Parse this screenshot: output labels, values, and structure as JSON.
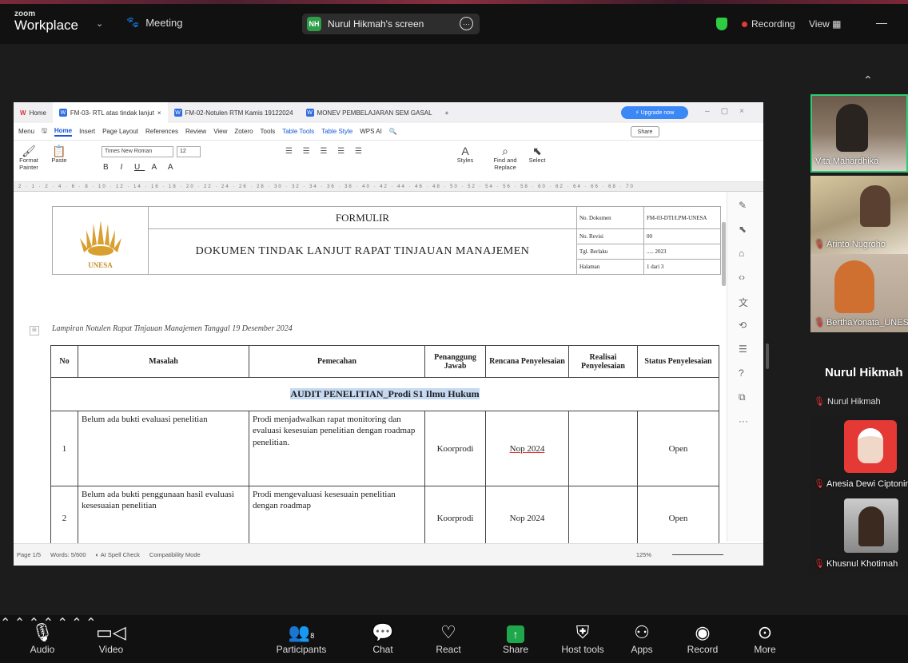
{
  "zoom": {
    "brand_small": "zoom",
    "brand_large": "Workplace",
    "meeting_label": "Meeting",
    "share_badge": "NH",
    "share_title": "Nurul Hikmah's screen",
    "recording": "Recording",
    "view": "View",
    "big_name": "Nurul Hikmah",
    "small_name": "Nurul Hikmah",
    "participants_count": "8"
  },
  "participants": [
    {
      "name": "Vita Mahardhika"
    },
    {
      "name": "Arinto Nugroho"
    },
    {
      "name": "BerthaYonata_UNESA"
    },
    {
      "name": "Anesia Dewi Ciptonin"
    },
    {
      "name": "Khusnul Khotimah"
    }
  ],
  "toolbar": [
    {
      "label": "Audio",
      "icon": "mic-muted-icon"
    },
    {
      "label": "Video",
      "icon": "video-icon"
    },
    {
      "label": "Participants",
      "icon": "participants-icon"
    },
    {
      "label": "Chat",
      "icon": "chat-icon"
    },
    {
      "label": "React",
      "icon": "heart-icon"
    },
    {
      "label": "Share",
      "icon": "share-icon"
    },
    {
      "label": "Host tools",
      "icon": "shield-icon"
    },
    {
      "label": "Apps",
      "icon": "apps-icon"
    },
    {
      "label": "Record",
      "icon": "record-icon"
    },
    {
      "label": "More",
      "icon": "more-icon"
    }
  ],
  "wps": {
    "home_tab": "Home",
    "tabs": [
      "FM-03- RTL atas tindak lanjut",
      "FM-02-Notulen RTM Kamis 19122024",
      "MONEV PEMBELAJARAN SEM GASAL"
    ],
    "upgrade": "Upgrade now",
    "menu": [
      "Menu",
      "Home",
      "Insert",
      "Page Layout",
      "References",
      "Review",
      "View",
      "Zotero",
      "Tools",
      "Table Tools",
      "Table Style",
      "WPS AI"
    ],
    "share_btn": "Share",
    "font_name": "Times New Roman",
    "font_size": "12",
    "ribbon": {
      "format_painter": "Format Painter",
      "paste": "Paste",
      "styles": "Styles",
      "find_replace": "Find and Replace",
      "select": "Select"
    },
    "status": {
      "page": "Page 1/5",
      "words": "Words: 5/600",
      "spell": "AI Spell Check",
      "compat": "Compatibility Mode",
      "zoom": "125%"
    }
  },
  "doc": {
    "form_title": "FORMULIR",
    "doc_title": "DOKUMEN TINDAK LANJUT RAPAT TINJAUAN MANAJEMEN",
    "logo_text": "UNESA",
    "meta": [
      {
        "key": "No. Dokumen",
        "val": "FM-03-DTI/LPM-UNESA"
      },
      {
        "key": "No. Revisi",
        "val": "00"
      },
      {
        "key": "Tgl. Berlaku",
        "val": "..... 2023"
      },
      {
        "key": "Halaman",
        "val": "1 dari 3"
      }
    ],
    "lampiran": "Lampiran Notulen Rapat Tinjauan Manajemen Tanggal 19 Desember 2024",
    "headers": [
      "No",
      "Masalah",
      "Pemecahan",
      "Penanggung Jawab",
      "Rencana Penyelesaian",
      "Realisai Penyelesaian",
      "Status Penyelesaian"
    ],
    "section": "AUDIT PENELITIAN_Prodi S1 Ilmu Hukum",
    "rows": [
      {
        "no": "1",
        "masalah": "Belum ada bukti evaluasi penelitian",
        "pemecahan": "Prodi menjadwalkan rapat monitoring dan evaluasi kesesuian penelitian dengan roadmap penelitian.",
        "pj": "Koorprodi",
        "rencana": "Nop 2024",
        "realisasi": "",
        "status": "Open"
      },
      {
        "no": "2",
        "masalah": "Belum ada bukti penggunaan hasil evaluasi kesesuaian penelitian",
        "pemecahan": "Prodi mengevaluasi kesesuain penelitian dengan roadmap",
        "pj": "Koorprodi",
        "rencana": "Nop 2024",
        "realisasi": "",
        "status": "Open"
      }
    ]
  }
}
